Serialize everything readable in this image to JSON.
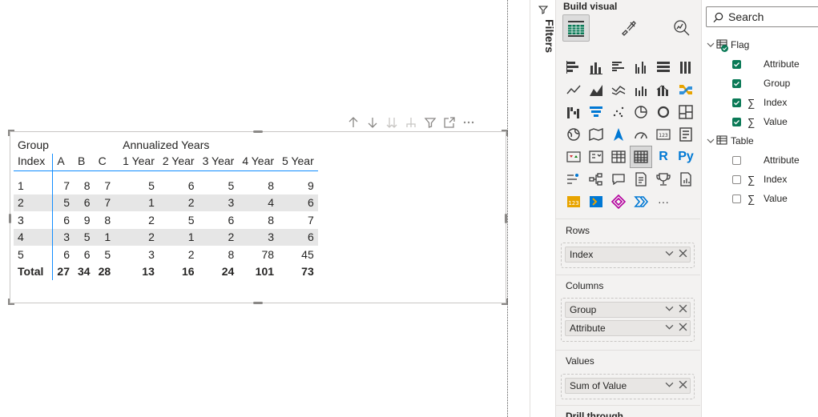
{
  "visual_header": {
    "icons": [
      "arrow-up-icon",
      "arrow-down-icon",
      "double-arrow-down-icon",
      "expand-hierarchy-icon",
      "filter-icon",
      "focus-mode-icon",
      "more-options-icon"
    ]
  },
  "matrix": {
    "header_row1": {
      "corner": "Group",
      "groups": [
        "",
        "",
        ""
      ],
      "annual_title": "Annualized Years"
    },
    "header_row2": {
      "corner": "Index",
      "columns": [
        "A",
        "B",
        "C",
        "1 Year",
        "2 Year",
        "3 Year",
        "4 Year",
        "5 Year"
      ]
    },
    "rows": [
      {
        "index": "1",
        "values": [
          "7",
          "8",
          "7",
          "5",
          "6",
          "5",
          "8",
          "9"
        ]
      },
      {
        "index": "2",
        "values": [
          "5",
          "6",
          "7",
          "1",
          "2",
          "3",
          "4",
          "6"
        ]
      },
      {
        "index": "3",
        "values": [
          "6",
          "9",
          "8",
          "2",
          "5",
          "6",
          "8",
          "7"
        ]
      },
      {
        "index": "4",
        "values": [
          "3",
          "5",
          "1",
          "2",
          "1",
          "2",
          "3",
          "6"
        ]
      },
      {
        "index": "5",
        "values": [
          "6",
          "6",
          "5",
          "3",
          "2",
          "8",
          "78",
          "45"
        ]
      }
    ],
    "total": {
      "label": "Total",
      "values": [
        "27",
        "34",
        "28",
        "13",
        "16",
        "24",
        "101",
        "73"
      ]
    }
  },
  "filters": {
    "label": "Filters"
  },
  "viz_pane": {
    "title": "Build visual",
    "tabs": [
      "build-visual-tab",
      "format-visual-tab",
      "analytics-tab"
    ],
    "gallery_text_icons": {
      "r": "R",
      "py": "Py",
      "more": "···"
    }
  },
  "wells": {
    "rows": {
      "title": "Rows",
      "fields": [
        "Index"
      ]
    },
    "columns": {
      "title": "Columns",
      "fields": [
        "Group",
        "Attribute"
      ]
    },
    "values": {
      "title": "Values",
      "fields": [
        "Sum of Value"
      ]
    },
    "drill": {
      "title": "Drill through"
    }
  },
  "data_pane": {
    "search_placeholder": "Search",
    "tables": [
      {
        "name": "Flag",
        "fields": [
          {
            "name": "Attribute",
            "checked": true,
            "sigma": false
          },
          {
            "name": "Group",
            "checked": true,
            "sigma": false
          },
          {
            "name": "Index",
            "checked": true,
            "sigma": true
          },
          {
            "name": "Value",
            "checked": true,
            "sigma": true
          }
        ]
      },
      {
        "name": "Table",
        "fields": [
          {
            "name": "Attribute",
            "checked": false,
            "sigma": false
          },
          {
            "name": "Index",
            "checked": false,
            "sigma": true
          },
          {
            "name": "Value",
            "checked": false,
            "sigma": true
          }
        ]
      }
    ]
  },
  "colors": {
    "accent": "#118dff",
    "check": "#0b7a57",
    "band": "#e6e6e6"
  }
}
